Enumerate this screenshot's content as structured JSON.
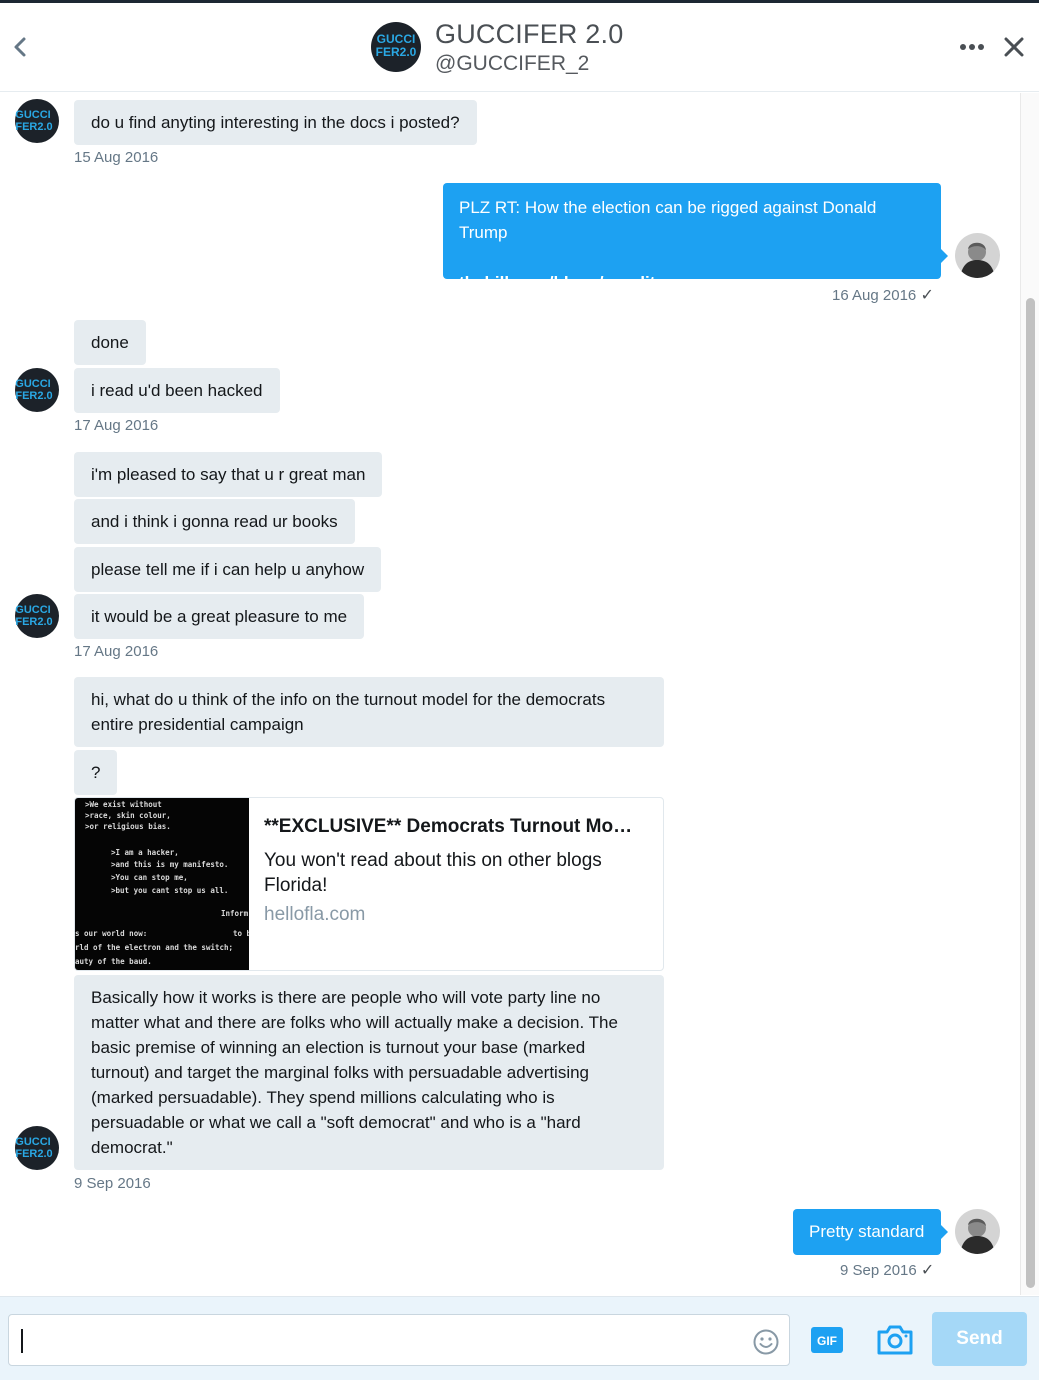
{
  "header": {
    "name": "GUCCIFER 2.0",
    "handle": "@GUCCIFER_2",
    "avatar_text_line1": "GUCCI",
    "avatar_text_line2": "FER2.0"
  },
  "colors": {
    "accent": "#1da1f2",
    "bubble_other": "#e6ecf0",
    "timestamp": "#657786",
    "send_disabled": "#a5d8f7"
  },
  "messages": [
    {
      "from": "other",
      "text": "do u find anyting interesting in the docs i posted?"
    },
    {
      "from": "me",
      "text": "PLZ RT: How the election can be rigged against Donald Trump",
      "link": "thehill.com/blogs/pundits-…"
    },
    {
      "from": "other",
      "text": "done"
    },
    {
      "from": "other",
      "text": "i read u'd been hacked"
    },
    {
      "from": "other",
      "text": "i'm pleased to say that u r great man"
    },
    {
      "from": "other",
      "text": "and i think i gonna read ur books"
    },
    {
      "from": "other",
      "text": "please tell me if i can help u anyhow"
    },
    {
      "from": "other",
      "text": "it would be a great pleasure to me"
    },
    {
      "from": "other",
      "text_line1": "hi, what do u think of the info on the turnout model for the democrats",
      "text_line2": "entire presidential campaign"
    },
    {
      "from": "other",
      "text": "?"
    },
    {
      "from": "other",
      "lines": [
        "Basically how it works is there are people who will vote party line no",
        "matter what and there are folks who will actually make a decision.  The",
        "basic premise of winning an election is turnout your base (marked",
        "turnout) and target the marginal folks with persuadable advertising",
        "(marked persuadable). They spend millions calculating  who is",
        "persuadable or what we call a \"soft democrat\" and who is a \"hard",
        "democrat.\""
      ]
    },
    {
      "from": "me",
      "text": "Pretty standard"
    }
  ],
  "timestamps": [
    "15 Aug 2016",
    "16 Aug 2016",
    "17 Aug 2016",
    "17 Aug 2016",
    "9 Sep 2016",
    "9 Sep 2016"
  ],
  "read_check": "✓",
  "card": {
    "title": "**EXCLUSIVE** Democrats Turnout Mo…",
    "description_line1": "You won't read about this on other blogs",
    "description_line2": "Florida!",
    "domain": "hellofla.com",
    "thumb_lines": [
      ">We exist without",
      ">race, skin colour,",
      ">or religious bias.",
      ">I am a hacker,",
      ">and this is my manifesto.",
      ">You can stop me,",
      ">but you cant stop us all.",
      "Inform",
      "s our world now:",
      "to be",
      "rld of the electron and the switch;",
      "auty of the baud."
    ]
  },
  "composer": {
    "placeholder": "",
    "gif_label": "GIF",
    "send_label": "Send"
  },
  "icons": {
    "back": "chevron-left-icon",
    "more": "more-dots-icon",
    "close": "close-icon",
    "emoji": "emoji-icon",
    "gif": "gif-icon",
    "camera": "camera-icon"
  }
}
